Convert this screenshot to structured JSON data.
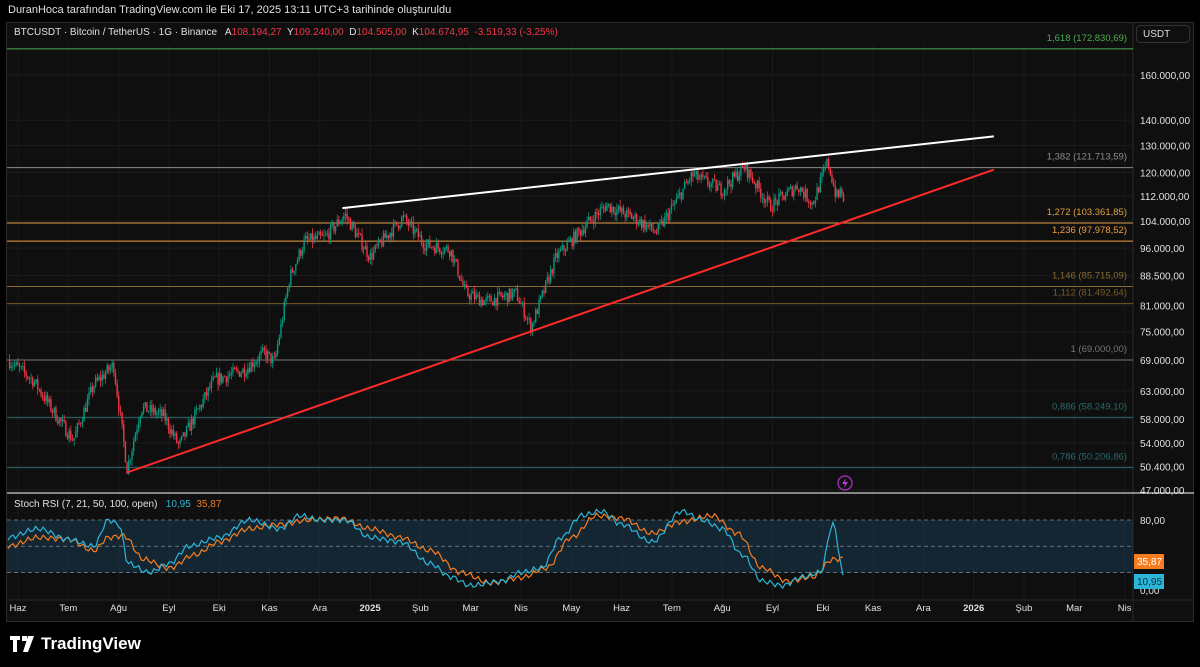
{
  "header": {
    "attribution": "DuranHoca tarafından TradingView.com ile Eki 17, 2025 13:11 UTC+3 tarihinde oluşturuldu"
  },
  "legend": {
    "symbol": "BTCUSDT · Bitcoin / TetherUS · 1G · Binance",
    "open_label": "A",
    "open": "108.194,27",
    "high_label": "Y",
    "high": "109.240,00",
    "low_label": "D",
    "low": "104.505,00",
    "close_label": "K",
    "close": "104.674,95",
    "change": "-3.519,33 (-3,25%)"
  },
  "currency": "USDT",
  "colors": {
    "up": "#089981",
    "down": "#f23645",
    "k": "#2bb5d8",
    "d": "#f57c1f",
    "trend_white": "#ffffff",
    "trend_red": "#ff2a2a"
  },
  "chart_data": {
    "type": "candlestick",
    "price_axis": {
      "scale": "log",
      "ticks": [
        160000,
        140000,
        130000,
        120000,
        112000,
        104000,
        96000,
        88500,
        81000,
        75000,
        69000,
        63000,
        58000,
        54000,
        50400,
        47000
      ],
      "tick_labels": [
        "160.000,00",
        "140.000,00",
        "130.000,00",
        "120.000,00",
        "112.000,00",
        "104.000,00",
        "96.000,00",
        "88.500,00",
        "81.000,00",
        "75.000,00",
        "69.000,00",
        "63.000,00",
        "58.000,00",
        "54.000,00",
        "50.400,00",
        "47.000,00"
      ]
    },
    "time_axis": {
      "labels": [
        "Haz",
        "Tem",
        "Ağu",
        "Eyl",
        "Eki",
        "Kas",
        "Ara",
        "2025",
        "Şub",
        "Mar",
        "Nis",
        "May",
        "Haz",
        "Tem",
        "Ağu",
        "Eyl",
        "Eki",
        "Kas",
        "Ara",
        "2026",
        "Şub",
        "Mar",
        "Nis"
      ]
    },
    "price_path_month_index_vs_price": [
      [
        -0.2,
        69000
      ],
      [
        0.3,
        65000
      ],
      [
        0.8,
        58000
      ],
      [
        1.1,
        54500
      ],
      [
        1.5,
        64000
      ],
      [
        1.9,
        68000
      ],
      [
        2.17,
        50000
      ],
      [
        2.45,
        60000
      ],
      [
        2.9,
        58500
      ],
      [
        3.2,
        53500
      ],
      [
        3.9,
        65000
      ],
      [
        4.5,
        67000
      ],
      [
        4.9,
        70500
      ],
      [
        5.1,
        68500
      ],
      [
        5.4,
        88000
      ],
      [
        5.7,
        98000
      ],
      [
        6.1,
        99000
      ],
      [
        6.5,
        106000
      ],
      [
        7.0,
        93500
      ],
      [
        7.3,
        99000
      ],
      [
        7.65,
        105000
      ],
      [
        8.1,
        97000
      ],
      [
        8.6,
        95500
      ],
      [
        8.9,
        84000
      ],
      [
        9.3,
        82000
      ],
      [
        9.9,
        84000
      ],
      [
        10.2,
        76000
      ],
      [
        10.7,
        93500
      ],
      [
        11.3,
        103000
      ],
      [
        11.7,
        109000
      ],
      [
        12.3,
        104500
      ],
      [
        12.7,
        100500
      ],
      [
        13.0,
        108000
      ],
      [
        13.4,
        119000
      ],
      [
        14.0,
        114000
      ],
      [
        14.45,
        122000
      ],
      [
        14.95,
        108500
      ],
      [
        15.5,
        115500
      ],
      [
        15.8,
        109500
      ],
      [
        16.1,
        124000
      ],
      [
        16.25,
        113000
      ],
      [
        16.3,
        111000
      ],
      [
        16.37,
        115000
      ],
      [
        16.44,
        104675
      ]
    ],
    "fib_levels": [
      {
        "label": "1,618 (172.830,69)",
        "price": 172830.69,
        "color": "#4caf50"
      },
      {
        "label": "1,382 (121.713,59)",
        "price": 121713.59,
        "color": "#8c8c8c"
      },
      {
        "label": "1,272 (103.361,85)",
        "price": 103361.85,
        "color": "#e0a040"
      },
      {
        "label": "1,236 (97.978,52)",
        "price": 97978.52,
        "color": "#f0a040"
      },
      {
        "label": "1,146 (85.715,09)",
        "price": 85715.09,
        "color": "#8a6a30"
      },
      {
        "label": "1,112 (81.492,64)",
        "price": 81492.64,
        "color": "#7a5a28"
      },
      {
        "label": "1 (69.000,00)",
        "price": 69000,
        "color": "#777777"
      },
      {
        "label": "0,886 (58.249,10)",
        "price": 58249.1,
        "color": "#2a6a6a"
      },
      {
        "label": "0,786 (50.206,86)",
        "price": 50206.86,
        "color": "#2a6a6a"
      }
    ],
    "trendlines": [
      {
        "name": "resistance",
        "from": [
          6.45,
          108000
        ],
        "to": [
          19.4,
          133500
        ]
      },
      {
        "name": "support",
        "from": [
          2.17,
          49500
        ],
        "to": [
          19.4,
          121000
        ]
      }
    ],
    "stoch_rsi": {
      "label": "Stoch RSI (7, 21, 50, 100, open)",
      "k_value": "10,95",
      "d_value": "35,87",
      "axis_labels": [
        "80,00",
        "0,00"
      ],
      "bands": [
        80,
        50,
        20
      ],
      "k": [
        [
          -0.2,
          60
        ],
        [
          0.4,
          70
        ],
        [
          1.0,
          58
        ],
        [
          1.5,
          50
        ],
        [
          1.8,
          80
        ],
        [
          2.0,
          75
        ],
        [
          2.2,
          30
        ],
        [
          2.6,
          20
        ],
        [
          3.0,
          30
        ],
        [
          3.4,
          50
        ],
        [
          4.0,
          60
        ],
        [
          4.6,
          80
        ],
        [
          5.2,
          70
        ],
        [
          5.6,
          85
        ],
        [
          6.0,
          80
        ],
        [
          6.5,
          80
        ],
        [
          7.0,
          60
        ],
        [
          7.6,
          55
        ],
        [
          8.2,
          30
        ],
        [
          8.6,
          15
        ],
        [
          9.0,
          5
        ],
        [
          9.6,
          10
        ],
        [
          10.0,
          20
        ],
        [
          10.4,
          25
        ],
        [
          10.8,
          60
        ],
        [
          11.2,
          85
        ],
        [
          11.6,
          90
        ],
        [
          12.0,
          75
        ],
        [
          12.6,
          55
        ],
        [
          13.2,
          90
        ],
        [
          13.6,
          80
        ],
        [
          14.0,
          70
        ],
        [
          14.4,
          40
        ],
        [
          14.8,
          10
        ],
        [
          15.2,
          5
        ],
        [
          15.6,
          15
        ],
        [
          15.95,
          20
        ],
        [
          16.2,
          75
        ],
        [
          16.44,
          11
        ]
      ],
      "d": [
        [
          -0.2,
          50
        ],
        [
          0.4,
          60
        ],
        [
          1.0,
          58
        ],
        [
          1.5,
          45
        ],
        [
          1.8,
          60
        ],
        [
          2.1,
          62
        ],
        [
          2.5,
          35
        ],
        [
          3.0,
          25
        ],
        [
          3.5,
          40
        ],
        [
          4.0,
          55
        ],
        [
          4.6,
          70
        ],
        [
          5.2,
          75
        ],
        [
          5.8,
          80
        ],
        [
          6.4,
          82
        ],
        [
          7.0,
          70
        ],
        [
          7.6,
          60
        ],
        [
          8.2,
          45
        ],
        [
          8.8,
          20
        ],
        [
          9.4,
          8
        ],
        [
          10.0,
          14
        ],
        [
          10.5,
          25
        ],
        [
          11.0,
          60
        ],
        [
          11.5,
          85
        ],
        [
          12.0,
          82
        ],
        [
          12.6,
          65
        ],
        [
          13.2,
          78
        ],
        [
          13.8,
          85
        ],
        [
          14.3,
          65
        ],
        [
          14.8,
          25
        ],
        [
          15.3,
          10
        ],
        [
          15.8,
          15
        ],
        [
          16.2,
          35
        ],
        [
          16.44,
          36
        ]
      ]
    }
  },
  "footer": {
    "brand": "TradingView"
  }
}
